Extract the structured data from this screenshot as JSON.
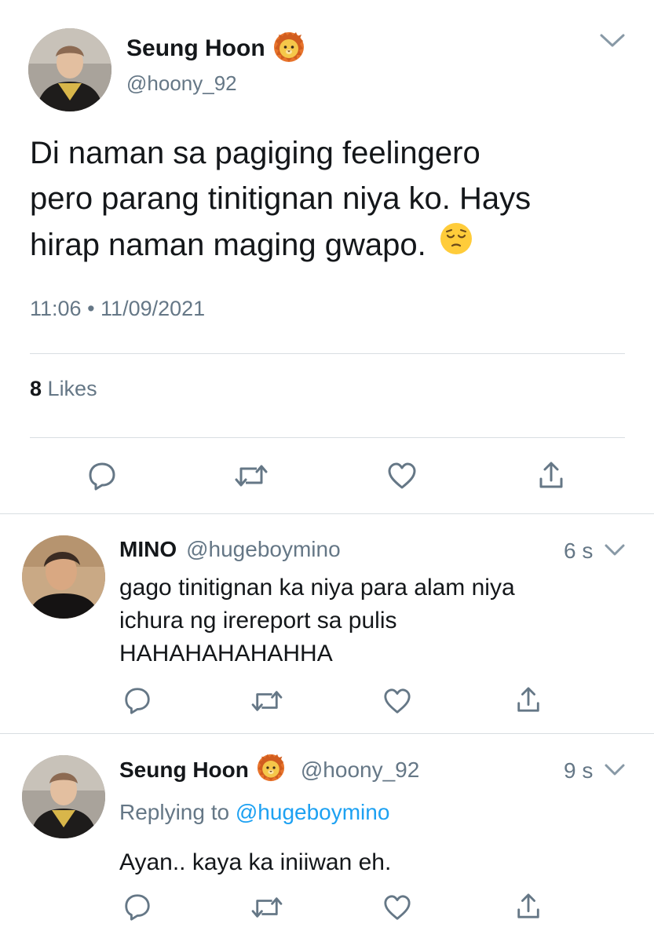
{
  "main_tweet": {
    "author_name": "Seung Hoon",
    "author_emoji": "lion-face",
    "handle": "@hoony_92",
    "text_lines": [
      "Di naman sa pagiging feelingero",
      "pero parang tinitignan niya ko. Hays",
      "hirap naman maging gwapo."
    ],
    "text_emoji": "pensive-face",
    "time": "11:06",
    "separator": "•",
    "date": "11/09/2021",
    "likes_count": "8",
    "likes_label": "Likes"
  },
  "replies": [
    {
      "author_name": "MINO",
      "handle": "@hugeboymino",
      "time_ago": "6 s",
      "text_lines": [
        "gago tinitignan ka niya para alam niya",
        "ichura ng irereport sa pulis",
        "HAHAHAHAHAHHA"
      ]
    },
    {
      "author_name": "Seung Hoon",
      "author_emoji": "lion-face",
      "handle": "@hoony_92",
      "time_ago": "9 s",
      "replying_prefix": "Replying to",
      "replying_handle": "@hugeboymino",
      "text_lines": [
        "Ayan.. kaya ka iniiwan eh."
      ]
    }
  ],
  "colors": {
    "text": "#14171a",
    "muted": "#657786",
    "link": "#1da1f2",
    "divider": "#d9dee2",
    "icon": "#657786"
  }
}
